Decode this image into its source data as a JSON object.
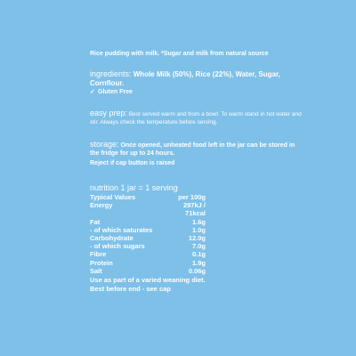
{
  "intro": "Rice pudding with milk. *Sugar and milk from natural source",
  "ingredients": {
    "label": "ingredients:",
    "text_prefix": " Whole ",
    "milk_bold": "Milk",
    "text_rest": " (50%), Rice (22%), Water, Sugar, Cornflour.",
    "gluten_free": "Gluten Free",
    "check_icon": "checkmark-icon"
  },
  "easy_prep": {
    "label": "easy prep:",
    "text": " Best served warm and from a bowl. To warm stand in hot water and stir. Always check the temperature before serving."
  },
  "storage": {
    "label": "storage:",
    "text": " Once opened, unheated food left in the jar can be stored in the fridge for up to 24 hours.",
    "reject": "Reject if cap button is raised"
  },
  "nutrition": {
    "title": "nutrition 1 jar = 1 serving",
    "header_left": "Typical Values",
    "header_right": "per 100g",
    "rows": [
      {
        "label": "Energy",
        "value": "297kJ /"
      },
      {
        "label": "",
        "value": "71kcal"
      },
      {
        "label": "Fat",
        "value": "1.6g"
      },
      {
        "label": "- of which saturates",
        "value": "1.0g"
      },
      {
        "label": "Carbohydrate",
        "value": "12.0g"
      },
      {
        "label": "- of which sugars",
        "value": "7.0g"
      },
      {
        "label": "Fibre",
        "value": "0.1g"
      },
      {
        "label": "Protein",
        "value": "1.9g"
      },
      {
        "label": "Salt",
        "value": "0.06g"
      }
    ],
    "note": "Use as part of a varied weaning diet.",
    "best_before": "Best before end - see cap"
  }
}
